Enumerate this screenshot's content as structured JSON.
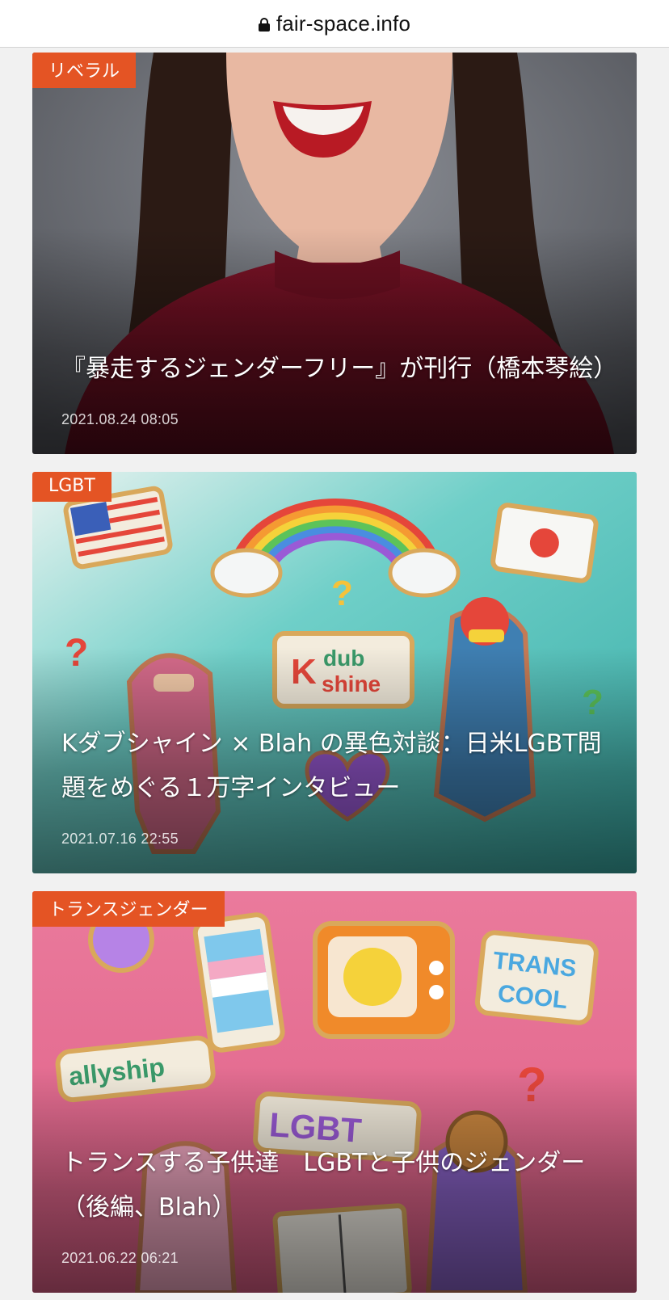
{
  "browser": {
    "url": "fair-space.info"
  },
  "articles": [
    {
      "category": "リベラル",
      "title": "『暴走するジェンダーフリー』が刊行（橋本琴絵）",
      "date": "2021.08.24 08:05",
      "thumbnail": "smiling-woman-photo"
    },
    {
      "category": "LGBT",
      "title": "Kダブシャイン × Blah の異色対談：日米LGBT問題をめぐる１万字インタビュー",
      "date": "2021.07.16 22:55",
      "thumbnail": "cookie-illustration-rainbow"
    },
    {
      "category": "トランスジェンダー",
      "title": "トランスする子供達　LGBTと子供のジェンダー（後編、Blah）",
      "date": "2021.06.22 06:21",
      "thumbnail": "cookie-illustration-trans"
    }
  ],
  "colors": {
    "badge": "#e45424",
    "page_background": "#f1f1f1"
  }
}
